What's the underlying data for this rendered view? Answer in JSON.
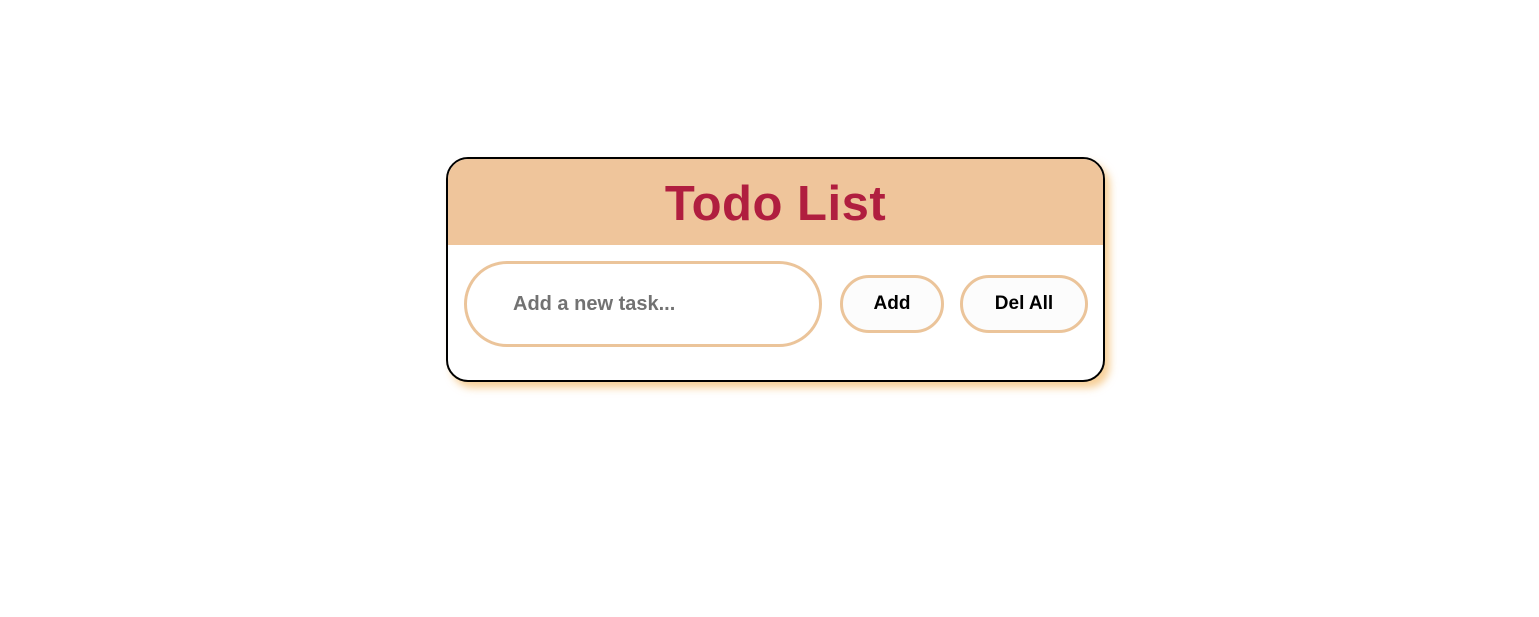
{
  "app": {
    "title": "Todo List"
  },
  "task_input": {
    "placeholder": "Add a new task...",
    "value": ""
  },
  "buttons": {
    "add_label": "Add",
    "delete_all_label": "Del All"
  },
  "colors": {
    "header_background": "#efc59b",
    "title_color": "#b01e3f",
    "accent_border": "#ebc49a",
    "card_border": "#000000",
    "shadow": "#f0aa46"
  }
}
